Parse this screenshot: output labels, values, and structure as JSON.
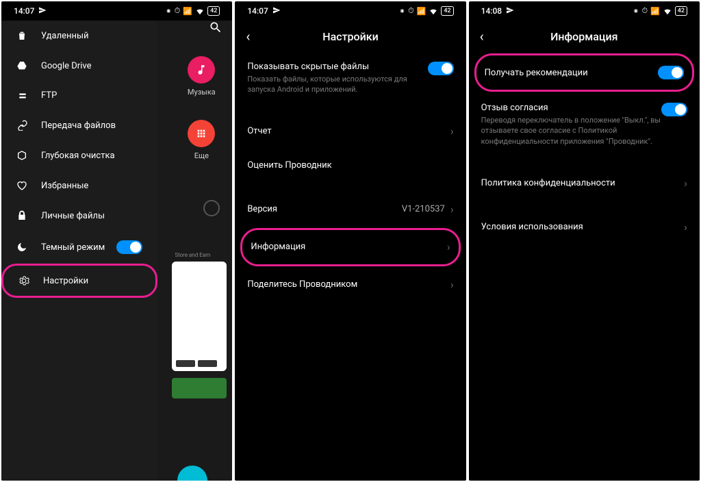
{
  "status1": {
    "time": "14:07",
    "battery": "42"
  },
  "status2": {
    "time": "14:07",
    "battery": "42"
  },
  "status3": {
    "time": "14:08",
    "battery": "42"
  },
  "phone1": {
    "categories": {
      "music": "Музыка",
      "more": "Еще"
    },
    "card_caption": "Store and Earn",
    "drawer": [
      {
        "icon": "trash",
        "label": "Удаленный"
      },
      {
        "icon": "gdrive",
        "label": "Google Drive"
      },
      {
        "icon": "ftp",
        "label": "FTP"
      },
      {
        "icon": "link",
        "label": "Передача файлов"
      },
      {
        "icon": "box",
        "label": "Глубокая очистка"
      },
      {
        "icon": "heart",
        "label": "Избранные"
      },
      {
        "icon": "lock",
        "label": "Личные файлы"
      },
      {
        "icon": "moon",
        "label": "Темный режим",
        "toggle": true
      },
      {
        "icon": "gear",
        "label": "Настройки",
        "highlight": true
      }
    ]
  },
  "phone2": {
    "title": "Настройки",
    "hidden": {
      "title": "Показывать скрытые файлы",
      "sub": "Показать файлы, которые используются для запуска Android и приложений."
    },
    "report": "Отчет",
    "rate": "Оценить Проводник",
    "version": "Версия",
    "version_value": "V1-210537",
    "info": "Информация",
    "share": "Поделитесь Проводником"
  },
  "phone3": {
    "title": "Информация",
    "recommend": "Получать рекомендации",
    "consent": {
      "title": "Отзыв согласия",
      "sub": "Переводя переключатель в положение \"Выкл.\", вы отзываете свое согласие с Политикой конфиденциальности приложения \"Проводник\"."
    },
    "privacy": "Политика конфиденциальности",
    "terms": "Условия использования"
  }
}
